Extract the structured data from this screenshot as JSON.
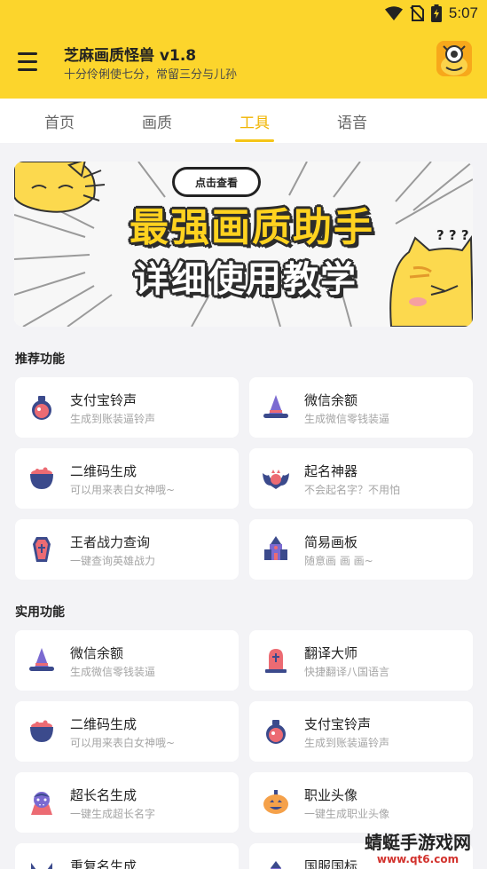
{
  "status_bar": {
    "time": "5:07"
  },
  "app_bar": {
    "title": "芝麻画质怪兽 v1.8",
    "subtitle": "十分伶俐使七分，常留三分与儿孙"
  },
  "tabs": [
    {
      "label": "首页",
      "active": false
    },
    {
      "label": "画质",
      "active": false
    },
    {
      "label": "工具",
      "active": true
    },
    {
      "label": "语音",
      "active": false
    }
  ],
  "banner": {
    "bubble": "点击查看",
    "line1": "最强画质助手",
    "line2": "详细使用教学",
    "question": "? ? ?"
  },
  "recommended": {
    "title": "推荐功能",
    "cards": [
      {
        "title": "支付宝铃声",
        "subtitle": "生成到账装逼铃声",
        "icon": "potion-icon"
      },
      {
        "title": "微信余额",
        "subtitle": "生成微信零钱装逼",
        "icon": "witch-hat-icon"
      },
      {
        "title": "二维码生成",
        "subtitle": "可以用来表白女神哦~",
        "icon": "cauldron-icon"
      },
      {
        "title": "起名神器",
        "subtitle": "不会起名字？不用怕",
        "icon": "bat-icon"
      },
      {
        "title": "王者战力查询",
        "subtitle": "一键查询英雄战力",
        "icon": "coffin-icon"
      },
      {
        "title": "简易画板",
        "subtitle": "随意画 画 画~",
        "icon": "haunted-house-icon"
      }
    ]
  },
  "practical": {
    "title": "实用功能",
    "cards": [
      {
        "title": "微信余额",
        "subtitle": "生成微信零钱装逼",
        "icon": "witch-hat-icon"
      },
      {
        "title": "翻译大师",
        "subtitle": "快捷翻译八国语言",
        "icon": "tombstone-icon"
      },
      {
        "title": "二维码生成",
        "subtitle": "可以用来表白女神哦~",
        "icon": "cauldron-icon"
      },
      {
        "title": "支付宝铃声",
        "subtitle": "生成到账装逼铃声",
        "icon": "potion-icon"
      },
      {
        "title": "超长名生成",
        "subtitle": "一键生成超长名字",
        "icon": "vampire-icon"
      },
      {
        "title": "职业头像",
        "subtitle": "一键生成职业头像",
        "icon": "pumpkin-icon"
      },
      {
        "title": "重复名生成",
        "subtitle": "",
        "icon": "cat-icon"
      },
      {
        "title": "国服国标",
        "subtitle": "",
        "icon": "castle-icon"
      }
    ]
  },
  "watermark": {
    "name": "蜻蜓手游戏网",
    "url": "www.qt6.com"
  },
  "colors": {
    "primary_yellow": "#fcd52c",
    "tab_active": "#f0b400",
    "icon_navy": "#3b4a8c",
    "icon_pink": "#ec6b73",
    "icon_purple": "#7b6ad1"
  }
}
